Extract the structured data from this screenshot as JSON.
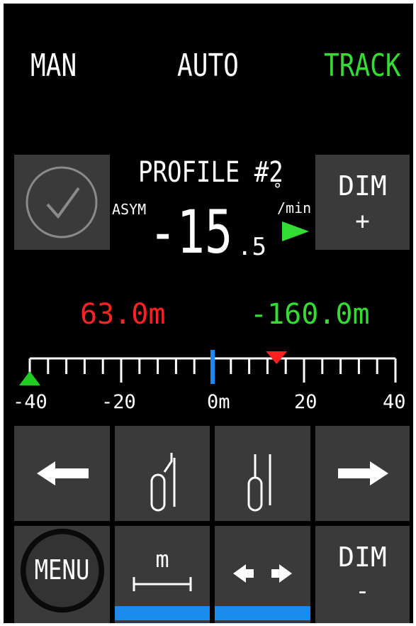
{
  "modes": {
    "man": "MAN",
    "auto": "AUTO",
    "track": "TRACK",
    "active_color": "#33dd33"
  },
  "profile": {
    "title": "PROFILE #2",
    "asym_label": "ASYM",
    "rate_main": "-15",
    "rate_decimal": ".5",
    "unit_degree": "°",
    "unit_per_min": "/min",
    "direction_icon": "play-right-icon"
  },
  "dim_plus": {
    "line1": "DIM",
    "line2": "+"
  },
  "dim_minus": {
    "line1": "DIM",
    "line2": "-"
  },
  "distances": {
    "left": "63.0m",
    "left_color": "#ff2222",
    "right": "-160.0m",
    "right_color": "#33dd33"
  },
  "scale": {
    "ticks": [
      "-40",
      "-20",
      "0m",
      "20",
      "40"
    ],
    "min": -40,
    "max": 40,
    "center_marker": 0,
    "red_marker": 14,
    "green_marker": -40
  },
  "buttons": {
    "menu": "MENU",
    "measure_unit": "m"
  },
  "colors": {
    "button_bg": "#3a3a3a",
    "accent_blue": "#1a8cf0",
    "marker_red": "#ff2020",
    "marker_green": "#22cc22"
  }
}
